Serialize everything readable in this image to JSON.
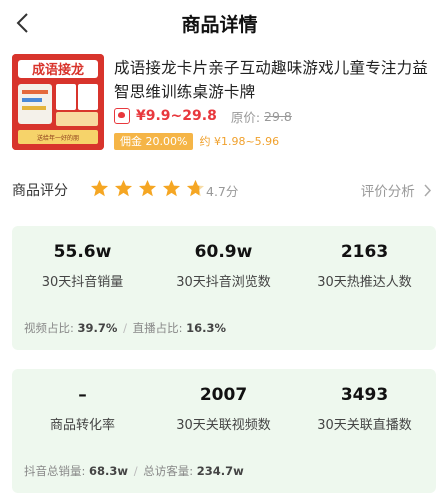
{
  "header": {
    "title": "商品详情"
  },
  "product": {
    "thumb_text": "成语接龙",
    "thumb_sub": "送给年一好的朋",
    "title": "成语接龙卡片亲子互动趣味游戏儿童专注力益智思维训练桌游卡牌",
    "price": "¥9.9~29.8",
    "original_label": "原价:",
    "original_price": "29.8",
    "commission_badge": "佣金 20.00%",
    "commission_range": "约 ¥1.98~5.96"
  },
  "rating": {
    "label": "商品评分",
    "stars": 4.7,
    "score_text": "4.7分",
    "link_label": "评价分析",
    "star_color": "#f5a623"
  },
  "card1": {
    "stats": [
      {
        "value": "55.6w",
        "label": "30天抖音销量"
      },
      {
        "value": "60.9w",
        "label": "30天抖音浏览数"
      },
      {
        "value": "2163",
        "label": "30天热推达人数"
      }
    ],
    "foot": [
      {
        "label": "视频占比:",
        "value": "39.7%"
      },
      {
        "label": "直播占比:",
        "value": "16.3%"
      }
    ]
  },
  "card2": {
    "stats": [
      {
        "value": "–",
        "label": "商品转化率"
      },
      {
        "value": "2007",
        "label": "30天关联视频数"
      },
      {
        "value": "3493",
        "label": "30天关联直播数"
      }
    ],
    "foot": [
      {
        "label": "抖音总销量:",
        "value": "68.3w"
      },
      {
        "label": "总访客量:",
        "value": "234.7w"
      }
    ]
  },
  "colors": {
    "price_red": "#e8383d",
    "card_bg": "#eef8ee",
    "commission": "#f5b547"
  },
  "icons": {
    "back": "chevron-left-icon",
    "review": "chevron-right-icon",
    "shop": "shop-icon"
  }
}
